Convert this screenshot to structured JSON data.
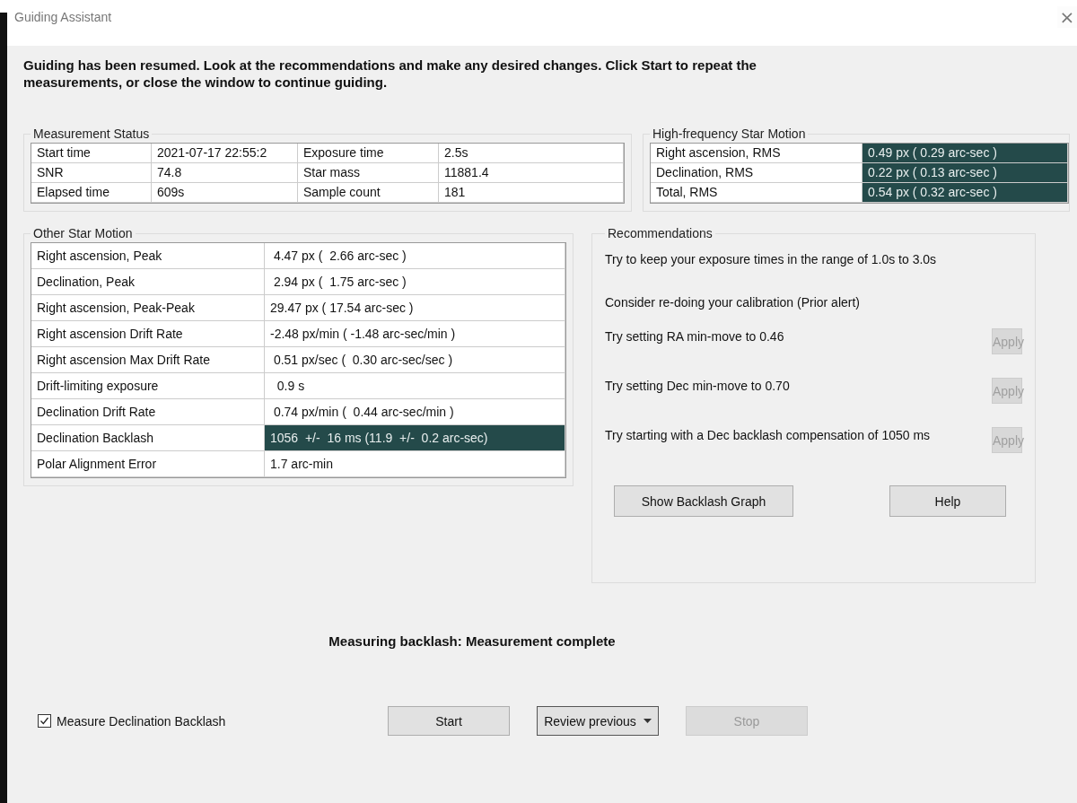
{
  "window": {
    "title": "Guiding Assistant",
    "close": "×"
  },
  "message": "Guiding has been resumed. Look at the recommendations and make any desired changes.  Click Start to repeat the measurements, or close the window to continue guiding.",
  "measurement_status": {
    "title": "Measurement Status",
    "rows": [
      [
        "Start time",
        "2021-07-17 22:55:2",
        "Exposure time",
        "2.5s"
      ],
      [
        "SNR",
        "74.8",
        "Star mass",
        "11881.4"
      ],
      [
        "Elapsed time",
        "609s",
        "Sample count",
        "181"
      ]
    ]
  },
  "high_frequency": {
    "title": "High-frequency Star Motion",
    "rows": [
      {
        "label": "Right ascension, RMS",
        "value": "0.49 px ( 0.29 arc-sec )",
        "highlighted": true
      },
      {
        "label": "Declination, RMS",
        "value": "0.22 px ( 0.13 arc-sec )",
        "highlighted": true
      },
      {
        "label": "Total, RMS",
        "value": "0.54 px ( 0.32 arc-sec )",
        "highlighted": true
      }
    ]
  },
  "other_motion": {
    "title": "Other Star Motion",
    "rows": [
      {
        "label": "Right ascension, Peak",
        "value": " 4.47 px (  2.66 arc-sec )",
        "highlighted": false
      },
      {
        "label": "Declination, Peak",
        "value": " 2.94 px (  1.75 arc-sec )",
        "highlighted": false
      },
      {
        "label": "Right ascension, Peak-Peak",
        "value": "29.47 px ( 17.54 arc-sec )",
        "highlighted": false
      },
      {
        "label": "Right ascension Drift Rate",
        "value": "-2.48 px/min ( -1.48 arc-sec/min )",
        "highlighted": false
      },
      {
        "label": "Right ascension Max Drift Rate",
        "value": " 0.51 px/sec (  0.30 arc-sec/sec )",
        "highlighted": false
      },
      {
        "label": "Drift-limiting exposure",
        "value": "  0.9 s",
        "highlighted": false
      },
      {
        "label": "Declination Drift Rate",
        "value": " 0.74 px/min (  0.44 arc-sec/min )",
        "highlighted": false
      },
      {
        "label": "Declination Backlash",
        "value": "1056  +/-  16 ms (11.9  +/-  0.2 arc-sec)",
        "highlighted": true
      },
      {
        "label": "Polar Alignment Error",
        "value": "1.7 arc-min",
        "highlighted": false
      }
    ]
  },
  "recommendations": {
    "title": "Recommendations",
    "items": [
      {
        "text": "Try to keep your exposure times in the range of 1.0s to 3.0s"
      },
      {
        "text": "Consider re-doing your calibration (Prior alert)"
      },
      {
        "text": "Try setting RA min-move to 0.46",
        "button": "Apply",
        "disabled": true
      },
      {
        "text": "Try setting Dec min-move to 0.70",
        "button": "Apply",
        "disabled": true
      },
      {
        "text": "Try starting with a Dec backlash compensation of 1050 ms",
        "button": "Apply",
        "disabled": true
      }
    ],
    "buttons": [
      "Show Backlash Graph",
      "Help"
    ]
  },
  "status": "Measuring backlash: Measurement complete",
  "checkbox": {
    "label": "Measure Declination Backlash",
    "checked": true
  },
  "buttons": [
    {
      "label": "Start",
      "kind": "plain",
      "disabled": false
    },
    {
      "label": "Review previous",
      "kind": "dropdown",
      "disabled": false
    },
    {
      "label": "Stop",
      "kind": "plain",
      "disabled": true
    }
  ]
}
